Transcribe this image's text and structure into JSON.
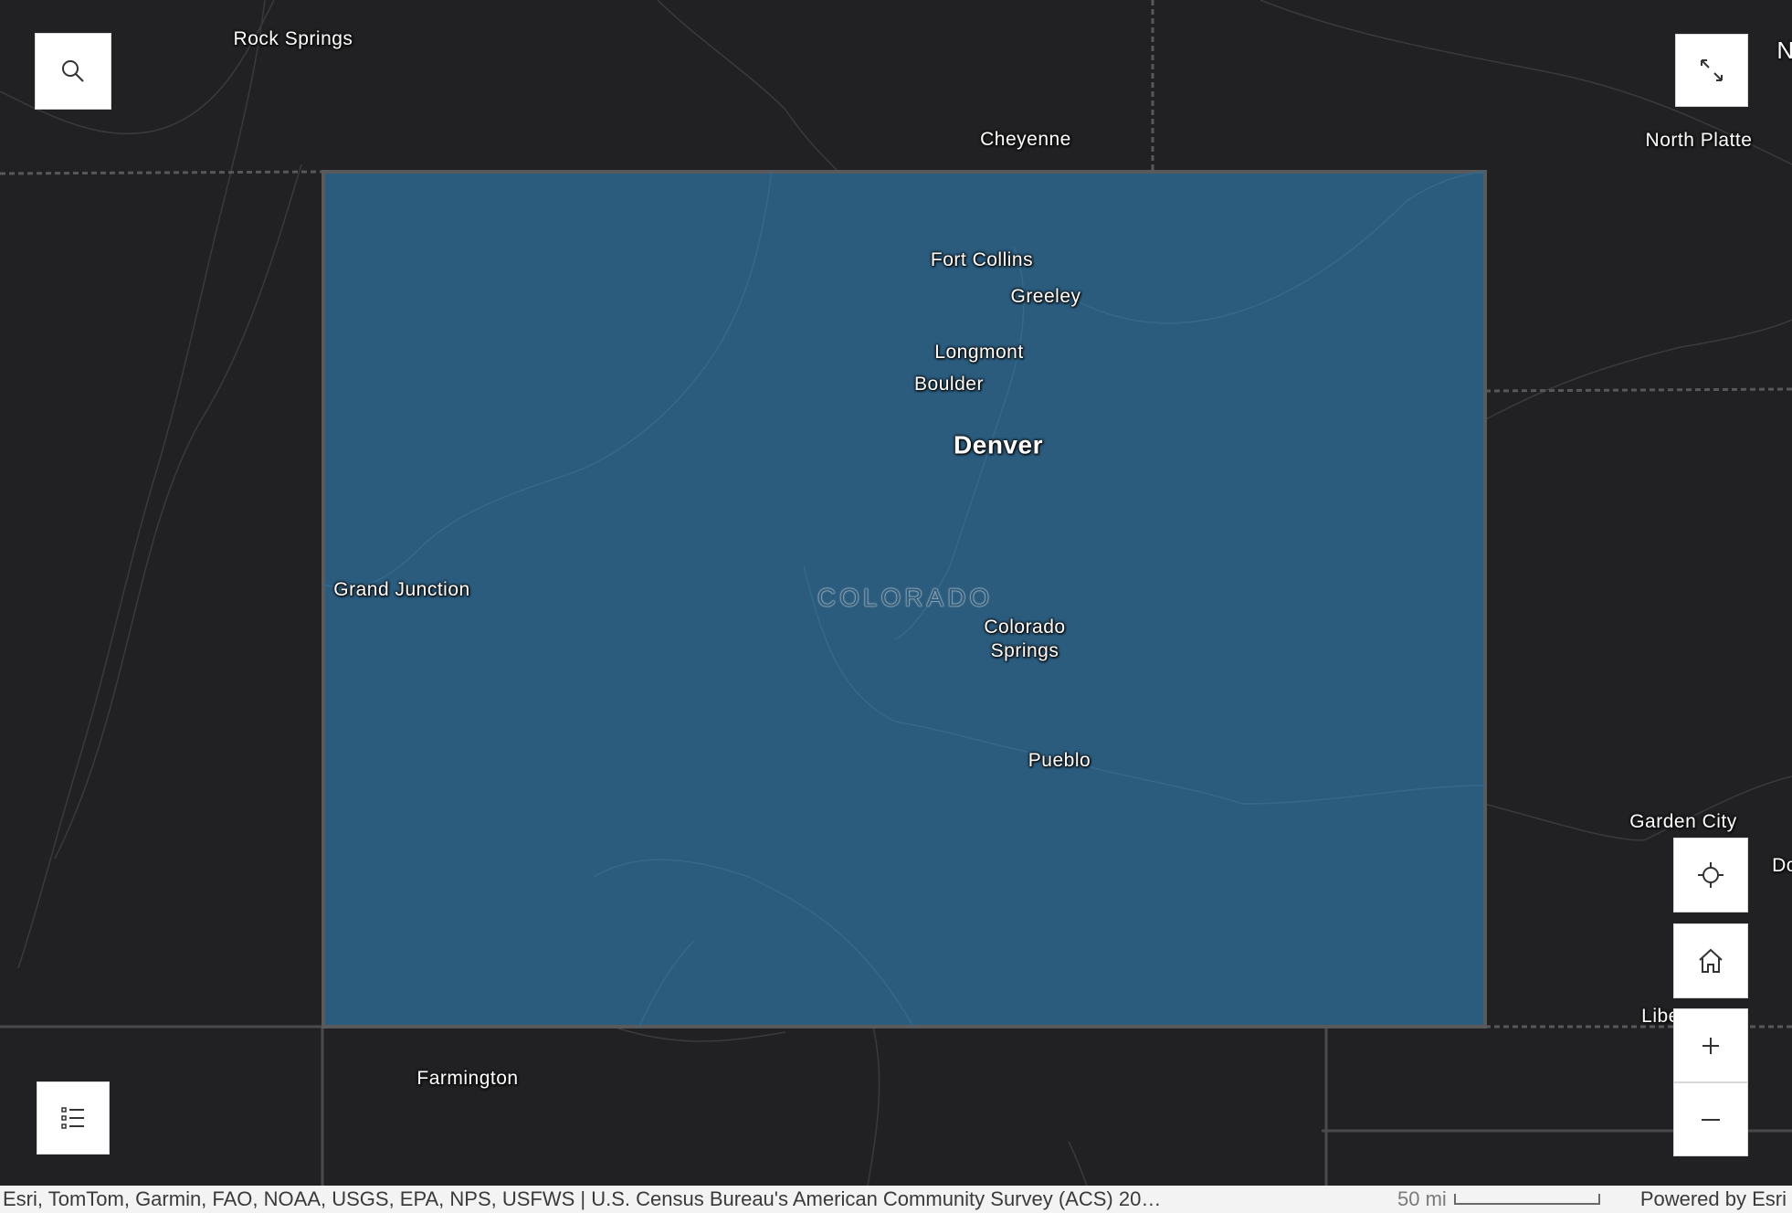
{
  "map": {
    "state_label": "COLORADO",
    "colors": {
      "background": "#212123",
      "highlight_fill": "#2b5c7e",
      "border": "#4a4a4c"
    },
    "places": [
      {
        "name": "Rock Springs",
        "style": "normal"
      },
      {
        "name": "Cheyenne",
        "style": "normal"
      },
      {
        "name": "North Platte",
        "style": "normal"
      },
      {
        "name": "Fort Collins",
        "style": "normal"
      },
      {
        "name": "Greeley",
        "style": "normal"
      },
      {
        "name": "Longmont",
        "style": "normal"
      },
      {
        "name": "Boulder",
        "style": "normal"
      },
      {
        "name": "Denver",
        "style": "capital"
      },
      {
        "name": "Grand Junction",
        "style": "normal"
      },
      {
        "name": "Colorado Springs",
        "style": "normal"
      },
      {
        "name": "Pueblo",
        "style": "normal"
      },
      {
        "name": "Garden City",
        "style": "normal"
      },
      {
        "name": "Farmington",
        "style": "normal"
      },
      {
        "name": "Libe",
        "style": "clipped"
      },
      {
        "name": "Do",
        "style": "clipped"
      },
      {
        "name": "N",
        "style": "clipped"
      }
    ]
  },
  "controls": {
    "search": {
      "icon": "search-icon"
    },
    "fullscreen": {
      "icon": "expand-icon"
    },
    "locate": {
      "icon": "crosshair-icon"
    },
    "home": {
      "icon": "home-icon"
    },
    "zoom_in": {
      "icon": "plus-icon"
    },
    "zoom_out": {
      "icon": "minus-icon"
    },
    "legend": {
      "icon": "legend-list-icon"
    }
  },
  "attribution": {
    "text": "Esri, TomTom, Garmin, FAO, NOAA, USGS, EPA, NPS, USFWS | U.S. Census Bureau's American Community Survey (ACS) 20…",
    "scale_label": "50 mi",
    "powered_by": "Powered by Esri"
  }
}
